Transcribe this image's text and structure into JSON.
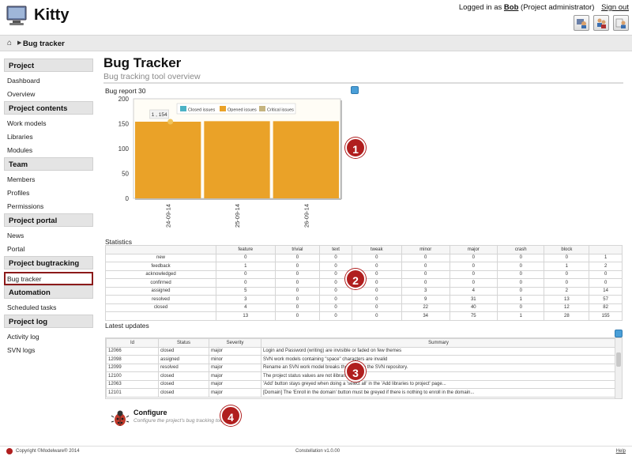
{
  "app": {
    "title": "Kitty"
  },
  "login": {
    "prefix": "Logged in as",
    "user": "Bob",
    "role": "(Project administrator)",
    "signout": "Sign out"
  },
  "breadcrumb": {
    "current": "Bug tracker"
  },
  "sidebar": {
    "sections": [
      {
        "title": "Project",
        "items": [
          "Dashboard",
          "Overview"
        ]
      },
      {
        "title": "Project contents",
        "items": [
          "Work models",
          "Libraries",
          "Modules"
        ]
      },
      {
        "title": "Team",
        "items": [
          "Members",
          "Profiles",
          "Permissions"
        ]
      },
      {
        "title": "Project portal",
        "items": [
          "News",
          "Portal"
        ]
      },
      {
        "title": "Project bugtracking",
        "items": [
          "Bug tracker"
        ]
      },
      {
        "title": "Automation",
        "items": [
          "Scheduled tasks"
        ]
      },
      {
        "title": "Project log",
        "items": [
          "Activity log",
          "SVN logs"
        ]
      }
    ],
    "active": "Bug tracker"
  },
  "page": {
    "title": "Bug Tracker",
    "subtitle": "Bug tracking tool overview"
  },
  "chart": {
    "label": "Bug report 30",
    "tooltip": "1 , 154"
  },
  "chart_data": {
    "type": "bar",
    "categories": [
      "24-09-14",
      "25-09-14",
      "26-09-14"
    ],
    "series": [
      {
        "name": "Closed issues",
        "values": [
          0,
          0,
          0
        ],
        "color": "#4bb2c5"
      },
      {
        "name": "Opened issues",
        "values": [
          154,
          155,
          155
        ],
        "color": "#eaa228"
      },
      {
        "name": "Critical issues",
        "values": [
          0,
          0,
          0
        ],
        "color": "#c5b47f"
      }
    ],
    "ylim": [
      0,
      200
    ],
    "yticks": [
      0,
      50,
      100,
      150,
      200
    ],
    "legend": "top-center",
    "grid": false
  },
  "statistics": {
    "label": "Statistics",
    "columns": [
      "",
      "feature",
      "trivial",
      "text",
      "tweak",
      "minor",
      "major",
      "crash",
      "block",
      ""
    ],
    "rows": [
      [
        "new",
        "0",
        "0",
        "0",
        "0",
        "0",
        "0",
        "0",
        "0",
        "1"
      ],
      [
        "feedback",
        "1",
        "0",
        "0",
        "0",
        "0",
        "0",
        "0",
        "1",
        "2"
      ],
      [
        "acknowledged",
        "0",
        "0",
        "0",
        "0",
        "0",
        "0",
        "0",
        "0",
        "0"
      ],
      [
        "confirmed",
        "0",
        "0",
        "0",
        "0",
        "0",
        "0",
        "0",
        "0",
        "0"
      ],
      [
        "assigned",
        "5",
        "0",
        "0",
        "0",
        "3",
        "4",
        "0",
        "2",
        "14"
      ],
      [
        "resolved",
        "3",
        "0",
        "0",
        "0",
        "9",
        "31",
        "1",
        "13",
        "57"
      ],
      [
        "closed",
        "4",
        "0",
        "0",
        "0",
        "22",
        "40",
        "0",
        "12",
        "82"
      ],
      [
        "",
        "13",
        "0",
        "0",
        "0",
        "34",
        "75",
        "1",
        "28",
        "155"
      ]
    ]
  },
  "updates": {
    "label": "Latest updates",
    "columns": [
      "Id",
      "Status",
      "Severity",
      "Summary"
    ],
    "rows": [
      [
        "12066",
        "closed",
        "major",
        "Login and Password (writing) are invisible or faded on few themes"
      ],
      [
        "12098",
        "assigned",
        "minor",
        "SVN work models containing \"space\" characters are invalid"
      ],
      [
        "12099",
        "resolved",
        "major",
        "Rename an SVN work model breaks the link with the SVN repository."
      ],
      [
        "12100",
        "closed",
        "major",
        "The project status values are not ilibraries"
      ],
      [
        "12063",
        "closed",
        "major",
        "'Add' button stays greyed when doing a 'select all' in the 'Add libraries to project' page..."
      ],
      [
        "12101",
        "closed",
        "major",
        "[Domain] The 'Enroll in the domain' button must be greyed if there is nothing to enroll in the domain..."
      ]
    ]
  },
  "configure": {
    "title": "Configure",
    "desc": "Configure the project's bug tracking tool"
  },
  "badges": [
    "1",
    "2",
    "3",
    "4"
  ],
  "footer": {
    "copyright": "Copyright ©Modelware® 2014",
    "version": "Constellation v1.0.00",
    "help": "Help"
  }
}
